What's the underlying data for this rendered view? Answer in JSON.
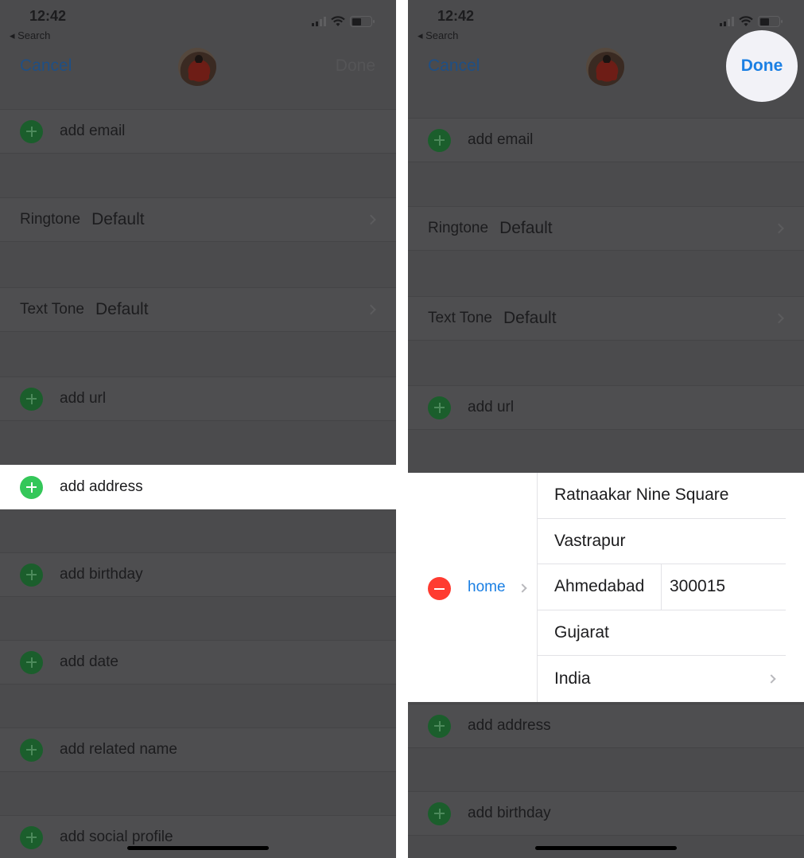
{
  "status_bar": {
    "time": "12:42",
    "back_label": "◂ Search"
  },
  "colors": {
    "accent_blue": "#1a7fe3",
    "add_green": "#34c759",
    "remove_red": "#ff3b30",
    "dim_overlay": "#4b4b4d"
  },
  "icons": {
    "signal": "cellular-signal-icon",
    "wifi": "wifi-icon",
    "battery": "battery-icon",
    "add": "plus-circle-icon",
    "remove": "minus-circle-icon",
    "chevron": "chevron-right-icon"
  },
  "left_panel": {
    "nav": {
      "cancel": "Cancel",
      "done": "Done"
    },
    "rows": [
      {
        "type": "add",
        "label": "add email"
      },
      {
        "type": "tone",
        "label": "Ringtone",
        "value": "Default"
      },
      {
        "type": "tone",
        "label": "Text Tone",
        "value": "Default"
      },
      {
        "type": "add",
        "label": "add url"
      },
      {
        "type": "add",
        "label": "add address",
        "highlighted": true
      },
      {
        "type": "add",
        "label": "add birthday"
      },
      {
        "type": "add",
        "label": "add date"
      },
      {
        "type": "add",
        "label": "add related name"
      },
      {
        "type": "add",
        "label": "add social profile"
      }
    ]
  },
  "right_panel": {
    "nav": {
      "cancel": "Cancel",
      "done": "Done",
      "done_highlighted": true
    },
    "rows": [
      {
        "type": "add",
        "label": "add email"
      },
      {
        "type": "tone",
        "label": "Ringtone",
        "value": "Default"
      },
      {
        "type": "tone",
        "label": "Text Tone",
        "value": "Default"
      },
      {
        "type": "add",
        "label": "add url"
      },
      {
        "type": "add",
        "label": "add address"
      },
      {
        "type": "add",
        "label": "add birthday"
      }
    ],
    "address": {
      "type_label": "home",
      "street1": "Ratnaakar Nine Square",
      "street2": "Vastrapur",
      "city": "Ahmedabad",
      "postal_code": "300015",
      "state": "Gujarat",
      "country": "India"
    }
  }
}
